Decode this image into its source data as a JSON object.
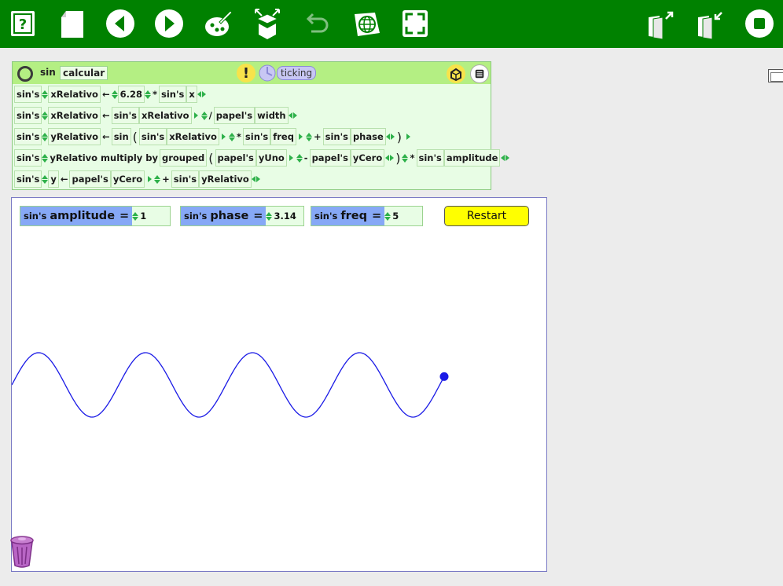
{
  "toolbar": {
    "left_buttons": [
      "help-icon",
      "new-page-icon",
      "back-icon",
      "forward-icon",
      "paint-icon",
      "open-box-icon",
      "undo-icon",
      "world-icon",
      "fullscreen-icon"
    ],
    "right_buttons": [
      "shrink-book-icon",
      "expand-book-icon",
      "stop-icon"
    ]
  },
  "script_block": {
    "object_name": "sin",
    "script_name": "calcular",
    "status": "ticking",
    "lines": [
      {
        "text": "sin's xRelativo ← 6.28 * sin's x"
      },
      {
        "text": "sin's xRelativo ← sin's xRelativo / papel's width"
      },
      {
        "text": "sin's yRelativo ← sin ( sin's xRelativo * sin's freq + sin's phase )"
      },
      {
        "text": "sin's yRelativo multiply by grouped ( papel's yUno - papel's yCero ) * sin's amplitude"
      },
      {
        "text": "sin's y ← papel's yCero + sin's yRelativo"
      }
    ],
    "tokens": {
      "l1": [
        "sin's",
        "xRelativo",
        "←",
        "6.28",
        "*",
        "sin's",
        "x"
      ],
      "l2": [
        "sin's",
        "xRelativo",
        "←",
        "sin's",
        "xRelativo",
        "/",
        "papel's",
        "width"
      ],
      "l3": [
        "sin's",
        "yRelativo",
        "←",
        "sin",
        "(",
        "sin's",
        "xRelativo",
        "*",
        "sin's",
        "freq",
        "+",
        "sin's",
        "phase",
        ")"
      ],
      "l4": [
        "sin's",
        "yRelativo",
        "multiply by",
        "grouped",
        "(",
        "papel's",
        "yUno",
        "-",
        "papel's",
        "yCero",
        ")",
        "*",
        "sin's",
        "amplitude"
      ],
      "l5": [
        "sin's",
        "y",
        "←",
        "papel's",
        "yCero",
        "+",
        "sin's",
        "yRelativo"
      ]
    }
  },
  "watchers": {
    "amplitude": {
      "owner": "sin's",
      "prop": "amplitude",
      "eq": "=",
      "value": "1"
    },
    "phase": {
      "owner": "sin's",
      "prop": "phase",
      "eq": "=",
      "value": "3.14"
    },
    "freq": {
      "owner": "sin's",
      "prop": "freq",
      "eq": "=",
      "value": "5"
    }
  },
  "restart_label": "Restart",
  "colors": {
    "toolbar": "#008100",
    "watcher_label": "#86a8f6",
    "restart": "#ffff00",
    "wave": "#1a1ae6"
  }
}
